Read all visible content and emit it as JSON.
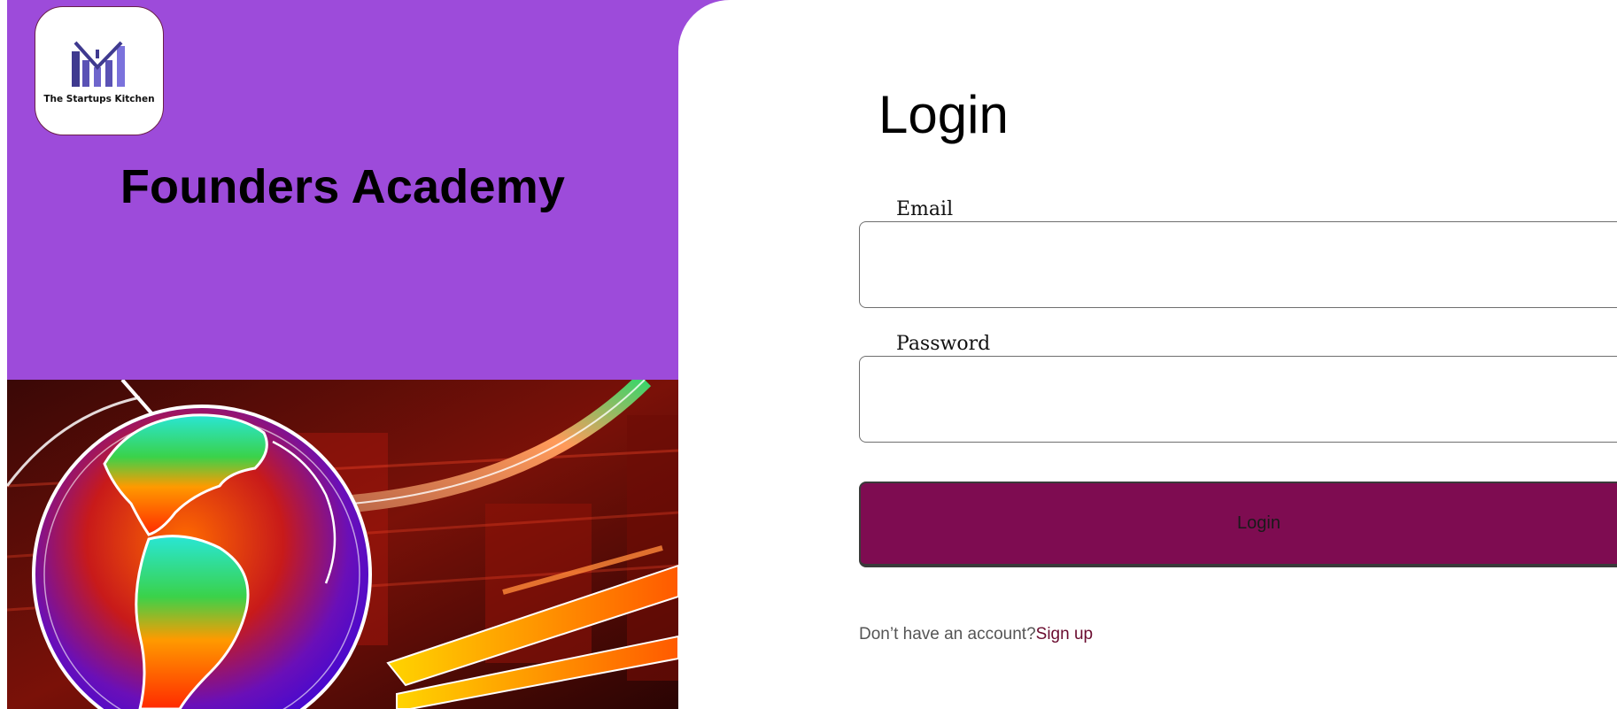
{
  "brand": {
    "logo_text": "The Startups Kitchen",
    "title": "Founders Academy"
  },
  "login": {
    "heading": "Login",
    "email_label": "Email",
    "email_value": "",
    "password_label": "Password",
    "password_value": "",
    "submit_label": "Login",
    "signup_prompt": "Don’t have an account?",
    "signup_link": "Sign up"
  },
  "colors": {
    "left_panel": "#9d4bda",
    "button": "#7e0c51",
    "link": "#6a0b2f"
  },
  "icons": {
    "logo": "startups-kitchen-logo-icon",
    "hero": "globe-illustration"
  }
}
